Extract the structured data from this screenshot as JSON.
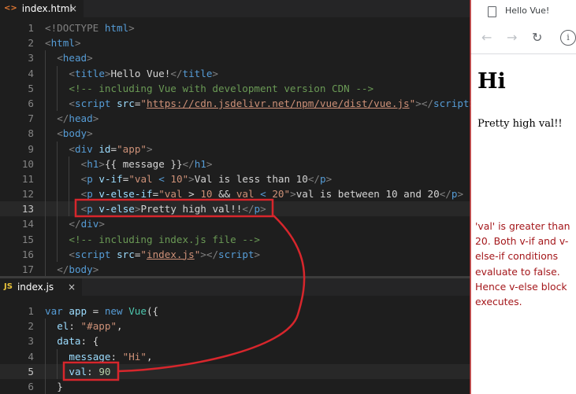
{
  "html_editor": {
    "tab": {
      "icon": "<>",
      "name": "index.html",
      "close": "×"
    },
    "lines": [
      {
        "n": "1",
        "indent": 0,
        "tokens": [
          [
            "doc",
            "<!DOCTYPE "
          ],
          [
            "tag",
            "html"
          ],
          [
            "doc",
            ">"
          ]
        ]
      },
      {
        "n": "2",
        "indent": 0,
        "tokens": [
          [
            "br",
            "<"
          ],
          [
            "tag",
            "html"
          ],
          [
            "br",
            ">"
          ]
        ]
      },
      {
        "n": "3",
        "indent": 1,
        "tokens": [
          [
            "br",
            "<"
          ],
          [
            "tag",
            "head"
          ],
          [
            "br",
            ">"
          ]
        ]
      },
      {
        "n": "4",
        "indent": 2,
        "tokens": [
          [
            "br",
            "<"
          ],
          [
            "tag",
            "title"
          ],
          [
            "br",
            ">"
          ],
          [
            "txt",
            "Hello Vue!"
          ],
          [
            "br",
            "</"
          ],
          [
            "tag",
            "title"
          ],
          [
            "br",
            ">"
          ]
        ]
      },
      {
        "n": "5",
        "indent": 2,
        "tokens": [
          [
            "cmt",
            "<!-- including Vue with development version CDN -->"
          ]
        ]
      },
      {
        "n": "6",
        "indent": 2,
        "tokens": [
          [
            "br",
            "<"
          ],
          [
            "tag",
            "script"
          ],
          [
            "txt",
            " "
          ],
          [
            "attr",
            "src"
          ],
          [
            "txt",
            "="
          ],
          [
            "str",
            "\""
          ],
          [
            "url",
            "https://cdn.jsdelivr.net/npm/vue/dist/vue.js"
          ],
          [
            "str",
            "\""
          ],
          [
            "br",
            "></"
          ],
          [
            "tag",
            "script"
          ],
          [
            "br",
            ">"
          ]
        ]
      },
      {
        "n": "7",
        "indent": 1,
        "tokens": [
          [
            "br",
            "</"
          ],
          [
            "tag",
            "head"
          ],
          [
            "br",
            ">"
          ]
        ]
      },
      {
        "n": "8",
        "indent": 1,
        "tokens": [
          [
            "br",
            "<"
          ],
          [
            "tag",
            "body"
          ],
          [
            "br",
            ">"
          ]
        ]
      },
      {
        "n": "9",
        "indent": 2,
        "tokens": [
          [
            "br",
            "<"
          ],
          [
            "tag",
            "div"
          ],
          [
            "txt",
            " "
          ],
          [
            "attr",
            "id"
          ],
          [
            "txt",
            "="
          ],
          [
            "str",
            "\"app\""
          ],
          [
            "br",
            ">"
          ]
        ]
      },
      {
        "n": "10",
        "indent": 3,
        "tokens": [
          [
            "br",
            "<"
          ],
          [
            "tag",
            "h1"
          ],
          [
            "br",
            ">"
          ],
          [
            "txt",
            "{{ message }}"
          ],
          [
            "br",
            "</"
          ],
          [
            "tag",
            "h1"
          ],
          [
            "br",
            ">"
          ]
        ]
      },
      {
        "n": "11",
        "indent": 3,
        "tokens": [
          [
            "br",
            "<"
          ],
          [
            "tag",
            "p"
          ],
          [
            "txt",
            " "
          ],
          [
            "attr",
            "v-if"
          ],
          [
            "txt",
            "="
          ],
          [
            "str",
            "\"val "
          ],
          [
            "tag",
            "<"
          ],
          [
            "str",
            " 10\""
          ],
          [
            "br",
            ">"
          ],
          [
            "txt",
            "Val is less than 10"
          ],
          [
            "br",
            "</"
          ],
          [
            "tag",
            "p"
          ],
          [
            "br",
            ">"
          ]
        ]
      },
      {
        "n": "12",
        "indent": 3,
        "tokens": [
          [
            "br",
            "<"
          ],
          [
            "tag",
            "p"
          ],
          [
            "txt",
            " "
          ],
          [
            "attr",
            "v-else-if"
          ],
          [
            "txt",
            "="
          ],
          [
            "str",
            "\"val "
          ],
          [
            "txt",
            ">"
          ],
          [
            "str",
            " 10 "
          ],
          [
            "txt",
            "&&"
          ],
          [
            "str",
            " val "
          ],
          [
            "tag",
            "<"
          ],
          [
            "str",
            " 20\""
          ],
          [
            "br",
            ">"
          ],
          [
            "txt",
            "val is between 10 and 20"
          ],
          [
            "br",
            "</"
          ],
          [
            "tag",
            "p"
          ],
          [
            "br",
            ">"
          ]
        ]
      },
      {
        "n": "13",
        "indent": 3,
        "current": true,
        "tokens": [
          [
            "br",
            "<"
          ],
          [
            "tag",
            "p"
          ],
          [
            "txt",
            " "
          ],
          [
            "attr",
            "v-else"
          ],
          [
            "br",
            ">"
          ],
          [
            "txt",
            "Pretty high val!!"
          ],
          [
            "br",
            "</"
          ],
          [
            "tag",
            "p"
          ],
          [
            "br",
            ">"
          ]
        ]
      },
      {
        "n": "14",
        "indent": 2,
        "tokens": [
          [
            "br",
            "</"
          ],
          [
            "tag",
            "div"
          ],
          [
            "br",
            ">"
          ]
        ]
      },
      {
        "n": "15",
        "indent": 2,
        "tokens": [
          [
            "cmt",
            "<!-- including index.js file -->"
          ]
        ]
      },
      {
        "n": "16",
        "indent": 2,
        "tokens": [
          [
            "br",
            "<"
          ],
          [
            "tag",
            "script"
          ],
          [
            "txt",
            " "
          ],
          [
            "attr",
            "src"
          ],
          [
            "txt",
            "="
          ],
          [
            "str",
            "\""
          ],
          [
            "url",
            "index.js"
          ],
          [
            "str",
            "\""
          ],
          [
            "br",
            "></"
          ],
          [
            "tag",
            "script"
          ],
          [
            "br",
            ">"
          ]
        ]
      },
      {
        "n": "17",
        "indent": 1,
        "tokens": [
          [
            "br",
            "</"
          ],
          [
            "tag",
            "body"
          ],
          [
            "br",
            ">"
          ]
        ]
      }
    ]
  },
  "js_editor": {
    "tab": {
      "icon": "JS",
      "name": "index.js",
      "close": "×"
    },
    "lines": [
      {
        "n": "1",
        "indent": 0,
        "tokens": [
          [
            "kw",
            "var"
          ],
          [
            "txt",
            " "
          ],
          [
            "var",
            "app"
          ],
          [
            "txt",
            " = "
          ],
          [
            "kw",
            "new"
          ],
          [
            "txt",
            " "
          ],
          [
            "fn",
            "Vue"
          ],
          [
            "txt",
            "({"
          ]
        ]
      },
      {
        "n": "2",
        "indent": 1,
        "tokens": [
          [
            "var",
            "el"
          ],
          [
            "txt",
            ": "
          ],
          [
            "str",
            "\"#app\""
          ],
          [
            "txt",
            ","
          ]
        ]
      },
      {
        "n": "3",
        "indent": 1,
        "tokens": [
          [
            "var",
            "data"
          ],
          [
            "txt",
            ": {"
          ]
        ]
      },
      {
        "n": "4",
        "indent": 2,
        "tokens": [
          [
            "var",
            "message"
          ],
          [
            "txt",
            ": "
          ],
          [
            "str",
            "\"Hi\""
          ],
          [
            "txt",
            ","
          ]
        ]
      },
      {
        "n": "5",
        "indent": 2,
        "current": true,
        "tokens": [
          [
            "var",
            "val"
          ],
          [
            "txt",
            ": "
          ],
          [
            "num",
            "90"
          ]
        ]
      },
      {
        "n": "6",
        "indent": 1,
        "tokens": [
          [
            "txt",
            "}"
          ]
        ]
      }
    ]
  },
  "browser": {
    "tab_title": "Hello Vue!",
    "nav": {
      "back": "←",
      "forward": "→",
      "reload": "↻",
      "info": "i"
    },
    "heading": "Hi",
    "paragraph": "Pretty high val!!",
    "note": "'val' is greater than 20. Both v-if and v-else-if conditions evaluate to false. Hence v-else block executes.",
    "note_color": "#a4171b"
  },
  "annotation_color": "#d7262c"
}
